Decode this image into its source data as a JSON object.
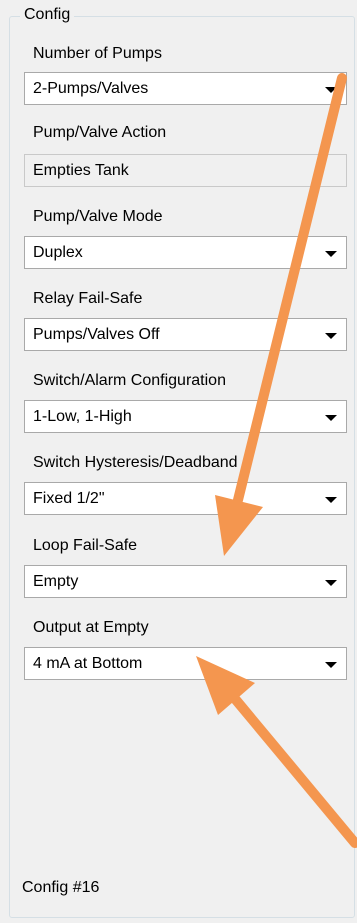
{
  "config": {
    "title": "Config",
    "fields": [
      {
        "label": "Number of Pumps",
        "value": "2-Pumps/Valves"
      },
      {
        "label": "Pump/Valve Action",
        "value": "Empties Tank"
      },
      {
        "label": "Pump/Valve Mode",
        "value": "Duplex"
      },
      {
        "label": "Relay Fail-Safe",
        "value": "Pumps/Valves Off"
      },
      {
        "label": "Switch/Alarm Configuration",
        "value": "1-Low, 1-High"
      },
      {
        "label": "Switch Hysteresis/Deadband",
        "value": "Fixed 1/2\""
      },
      {
        "label": "Loop Fail-Safe",
        "value": "Empty"
      },
      {
        "label": "Output at Empty",
        "value": "4 mA at Bottom"
      }
    ],
    "footer": "Config #16"
  },
  "annotation_color": "#f4964f"
}
